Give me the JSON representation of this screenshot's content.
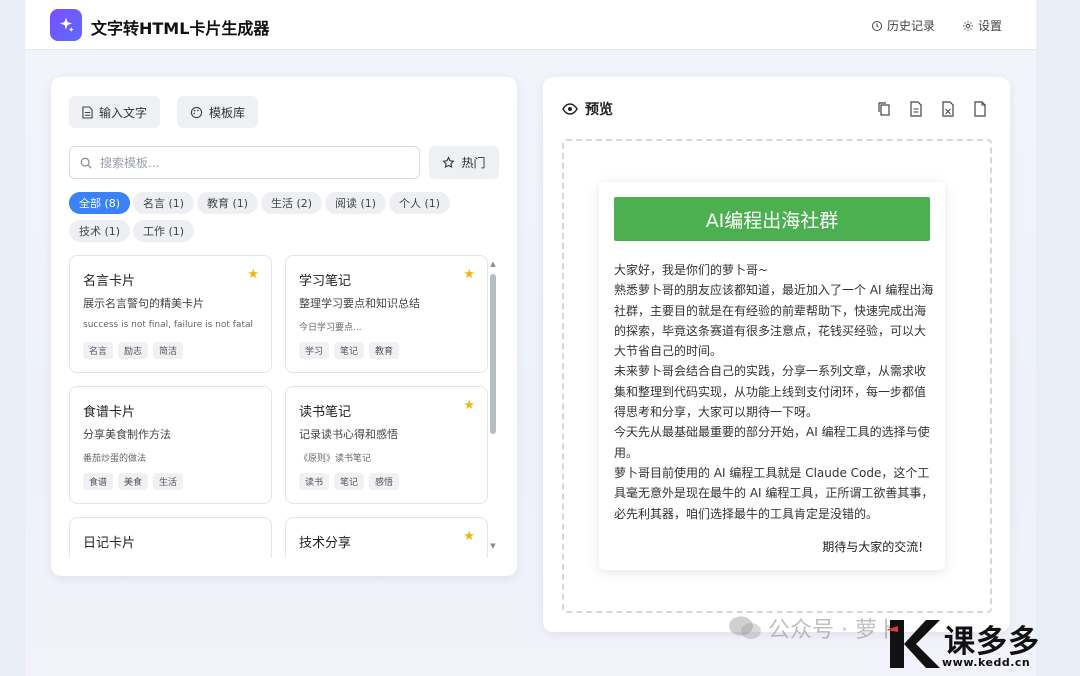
{
  "app": {
    "title": "文字转HTML卡片生成器"
  },
  "header": {
    "history_label": "历史记录",
    "settings_label": "设置"
  },
  "left": {
    "tabs": [
      {
        "label": "输入文字"
      },
      {
        "label": "模板库"
      }
    ],
    "search": {
      "placeholder": "搜索模板..."
    },
    "hot_label": "热门",
    "filters": [
      {
        "label": "全部 (8)",
        "active": true
      },
      {
        "label": "名言 (1)"
      },
      {
        "label": "教育 (1)"
      },
      {
        "label": "生活 (2)"
      },
      {
        "label": "阅读 (1)"
      },
      {
        "label": "个人 (1)"
      },
      {
        "label": "技术 (1)"
      },
      {
        "label": "工作 (1)"
      }
    ],
    "cards": [
      {
        "title": "名言卡片",
        "desc": "展示名言警句的精美卡片",
        "sample": "success is not final, failure is not fatal",
        "tags": [
          "名言",
          "励志",
          "简洁"
        ],
        "starred": true
      },
      {
        "title": "学习笔记",
        "desc": "整理学习要点和知识总结",
        "sample": "今日学习要点...",
        "tags": [
          "学习",
          "笔记",
          "教育"
        ],
        "starred": true
      },
      {
        "title": "食谱卡片",
        "desc": "分享美食制作方法",
        "sample": "番茄炒蛋的做法",
        "tags": [
          "食谱",
          "美食",
          "生活"
        ],
        "starred": false
      },
      {
        "title": "读书笔记",
        "desc": "记录读书心得和感悟",
        "sample": "《原则》读书笔记",
        "tags": [
          "读书",
          "笔记",
          "感悟"
        ],
        "starred": true
      },
      {
        "title": "日记卡片",
        "desc": "",
        "sample": "",
        "tags": [],
        "starred": false
      },
      {
        "title": "技术分享",
        "desc": "",
        "sample": "",
        "tags": [],
        "starred": true
      }
    ],
    "star_glyph": "★"
  },
  "preview": {
    "title": "预览",
    "poster": {
      "banner": "AI编程出海社群",
      "accent": "#4caf50",
      "lines": [
        "大家好，我是你们的萝卜哥~",
        "熟悉萝卜哥的朋友应该都知道，最近加入了一个 AI 编程出海社群，主要目的就是在有经验的前辈帮助下，快速完成出海的探索，毕竟这条赛道有很多注意点，花钱买经验，可以大大节省自己的时间。",
        "未来萝卜哥会结合自己的实践，分享一系列文章，从需求收集和整理到代码实现，从功能上线到支付闭环，每一步都值得思考和分享，大家可以期待一下呀。",
        "今天先从最基础最重要的部分开始，AI 编程工具的选择与使用。",
        "萝卜哥目前使用的 AI 编程工具就是 Claude Code，这个工具毫无意外是现在最牛的 AI 编程工具，正所谓工欲善其事，必先利其器，咱们选择最牛的工具肯定是没错的。"
      ],
      "sign": "期待与大家的交流!"
    }
  },
  "watermark": {
    "text": "公众号 · 萝卜"
  },
  "brand": {
    "name": "课多多",
    "url": "www.kedd.cn"
  }
}
